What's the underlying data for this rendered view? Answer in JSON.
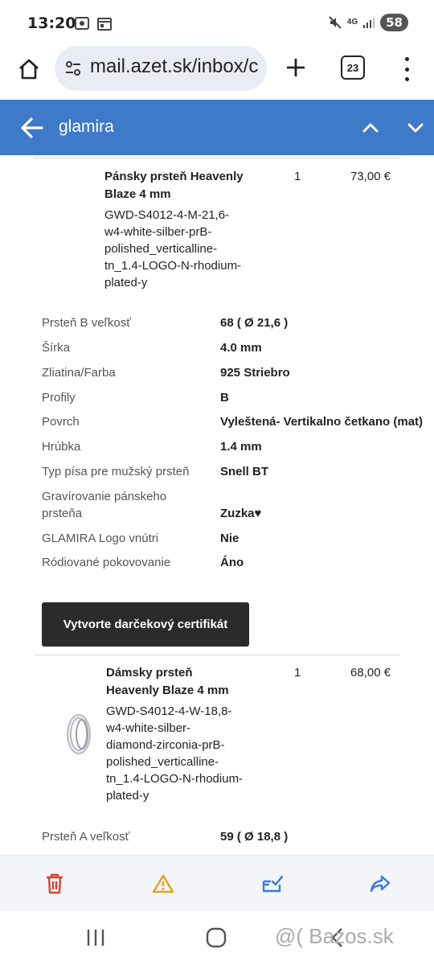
{
  "status_bar": {
    "time": "13:20",
    "battery": "58",
    "network": "4G"
  },
  "browser": {
    "url": "mail.azet.sk/inbox/c",
    "tab_count": "23"
  },
  "header": {
    "title": "glamira"
  },
  "item1": {
    "name_line1": "Pánsky prsteň Heavenly",
    "name_line2": "Blaze 4 mm",
    "sku_lines": [
      "GWD-S4012-4-M-21,6-",
      "w4-white-silber-prB-",
      "polished_verticalline-",
      "tn_1.4-LOGO-N-rhodium-",
      "plated-y"
    ],
    "qty": "1",
    "price": "73,00 €"
  },
  "attributes": [
    {
      "label": "Prsteň B veľkosť",
      "value": "68 ( Ø 21,6 )"
    },
    {
      "label": "Šírka",
      "value": "4.0 mm"
    },
    {
      "label": "Zliatina/Farba",
      "value": "925 Striebro"
    },
    {
      "label": "Profily",
      "value": "B"
    },
    {
      "label": "Povrch",
      "value": "Vyleštená- Vertikalno četkano (mat)"
    },
    {
      "label": "Hrúbka",
      "value": "1.4 mm"
    },
    {
      "label": "Typ písa pre mužský prsteň",
      "value": "Snell BT"
    },
    {
      "label_line1": "Gravírovanie pánskeho",
      "label_line2": "prsteňa",
      "value": "Zuzka♥"
    },
    {
      "label": "GLAMIRA Logo vnútri",
      "value": "Nie"
    },
    {
      "label": "Ródiované pokovovanie",
      "value": "Áno"
    }
  ],
  "gift_button": "Vytvorte darčekový certifikát",
  "item2": {
    "name_line1": "Dámsky prsteň",
    "name_line2": "Heavenly Blaze 4 mm",
    "sku_lines": [
      "GWD-S4012-4-W-18,8-",
      "w4-white-silber-",
      "diamond-zirconia-prB-",
      "polished_verticalline-",
      "tn_1.4-LOGO-N-rhodium-",
      "plated-y"
    ],
    "qty": "1",
    "price": "68,00 €",
    "attr_label": "Prsteň A veľkosť",
    "attr_value": "59 ( Ø 18,8 )"
  },
  "toolbar_icons": [
    "trash-icon",
    "warning-icon",
    "move-icon",
    "forward-icon"
  ],
  "colors": {
    "header_bg": "#3e7ac8",
    "delete": "#d9432f",
    "warning": "#e6a21a",
    "action": "#3a7bd5"
  },
  "watermark": "@( Bazos.sk"
}
